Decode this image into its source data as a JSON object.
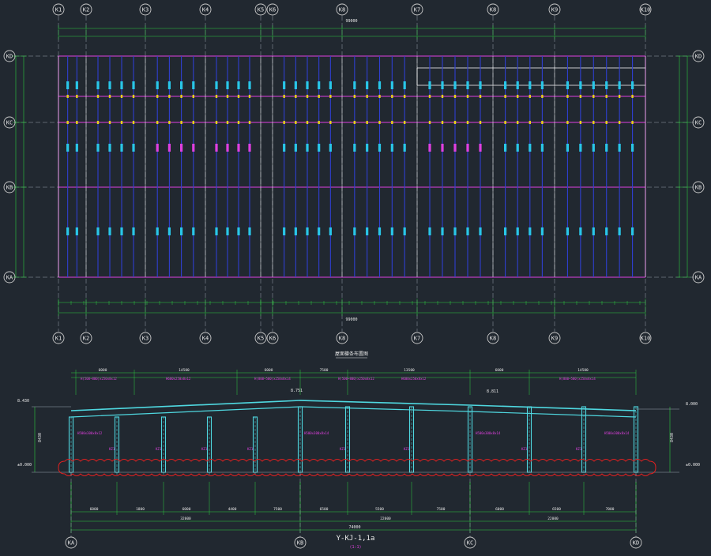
{
  "colors": {
    "background": "#212830",
    "grid_line": "#9aa3ad",
    "dimension": "#2ecc40",
    "beam_magenta": "#e040e0",
    "column_blue": "#2f3fd0",
    "frame_cyan": "#4fd8e0",
    "purlin_white": "#ffffff",
    "cloud_red": "#e02020",
    "bubble": "#c8c8c8",
    "tag_text": "#e040e0",
    "yellow_node": "#e8d21a"
  },
  "plan": {
    "grid_x_labels": [
      "K1",
      "K2",
      "K3",
      "K4",
      "K5",
      "K6",
      "K8",
      "K7",
      "K8",
      "K9",
      "K10"
    ],
    "grid_y_labels": [
      "KD",
      "KC",
      "KB",
      "KA"
    ],
    "top_total_dimension": "99000",
    "bottom_total_dimension": "99000",
    "plan_title": "屋面檩条布置图"
  },
  "section": {
    "label": "Y-KJ-1,1a",
    "sublabel": "(1:1)",
    "grid_labels": [
      "KA",
      "KB",
      "KC",
      "KD"
    ],
    "elevation_left_top": "8.430",
    "elevation_right_top": "8.000",
    "elevation_left_base": "±0.000",
    "elevation_right_base": "±0.000",
    "height_dim": "8430",
    "ridge_tags": [
      "8.751",
      "8.811"
    ],
    "overall_span": "74000",
    "sub_spans": [
      "32000",
      "22000",
      "22000"
    ],
    "segment_dims": [
      "6000",
      "14500",
      "6000",
      "7500",
      "13500",
      "6000",
      "14500"
    ],
    "bottom_dims": [
      "6000",
      "1800",
      "6000",
      "4400",
      "7500",
      "6500",
      "5500",
      "7500",
      "6000",
      "6500",
      "7000"
    ],
    "column_tags": [
      "KZ1",
      "KZ1",
      "KZ1",
      "KZ1",
      "KZ1",
      "KZ1",
      "KZ1",
      "KZ1"
    ],
    "beam_tags": [
      "H(500~800)x250x8x12",
      "H600x250x8x12",
      "H(800~500)x250x8x14",
      "H(500~800)x250x8x12",
      "H600x250x8x12",
      "H(800~500)x250x8x14"
    ],
    "side_tags": [
      "H500x300x8x12",
      "H500x300x8x14",
      "H500x300x8x14",
      "H500x300x8x14"
    ]
  }
}
